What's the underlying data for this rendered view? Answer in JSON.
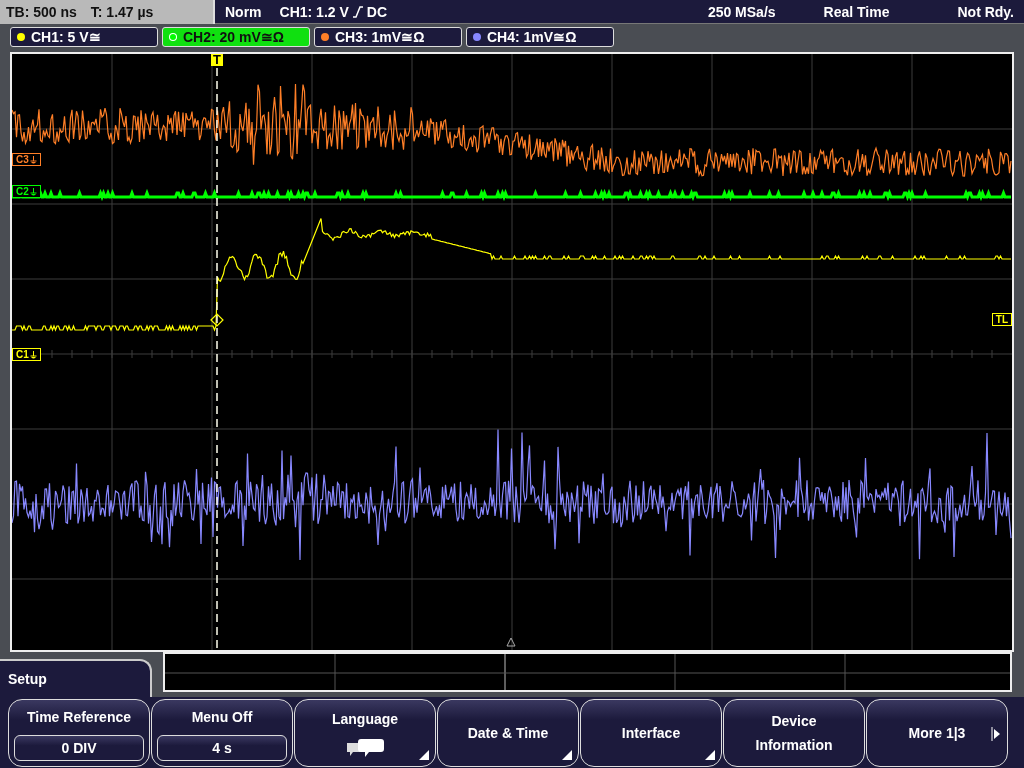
{
  "status_bar": {
    "timebase": "TB: 500 ns",
    "trigger_time": "T: 1.47 µs",
    "mode": "Norm",
    "trigger_source": "CH1: 1.2 V",
    "coupling": "DC",
    "sample_rate": "250 MSa/s",
    "acquisition": "Real Time",
    "state": "Not Rdy."
  },
  "channels": [
    {
      "label": "CH1: 5 V≅",
      "selected": false,
      "color": "#ffff00"
    },
    {
      "label": "CH2: 20 mV≅Ω",
      "selected": true,
      "color": "#00ff00"
    },
    {
      "label": "CH3: 1mV≅Ω",
      "selected": false,
      "color": "#ff7f27"
    },
    {
      "label": "CH4: 1mV≅Ω",
      "selected": false,
      "color": "#8888ff"
    }
  ],
  "channel_markers": [
    {
      "label": "C3",
      "color": "#ff7f27"
    },
    {
      "label": "C2",
      "color": "#00ff00"
    },
    {
      "label": "C1",
      "color": "#ffff00"
    }
  ],
  "trigger": {
    "marker": "T",
    "level_marker": "TL"
  },
  "menu": {
    "title": "Setup",
    "softkeys": [
      {
        "kind": "value",
        "label": "Time Reference",
        "value": "0 DIV"
      },
      {
        "kind": "value",
        "label": "Menu Off",
        "value": "4 s"
      },
      {
        "kind": "icon",
        "label": "Language",
        "submenu": true
      },
      {
        "kind": "plain",
        "label": "Date & Time",
        "submenu": true
      },
      {
        "kind": "plain",
        "label": "Interface",
        "submenu": true
      },
      {
        "kind": "plain",
        "label": "Device Information",
        "submenu": false
      },
      {
        "kind": "next",
        "label": "More 1|3"
      }
    ]
  }
}
